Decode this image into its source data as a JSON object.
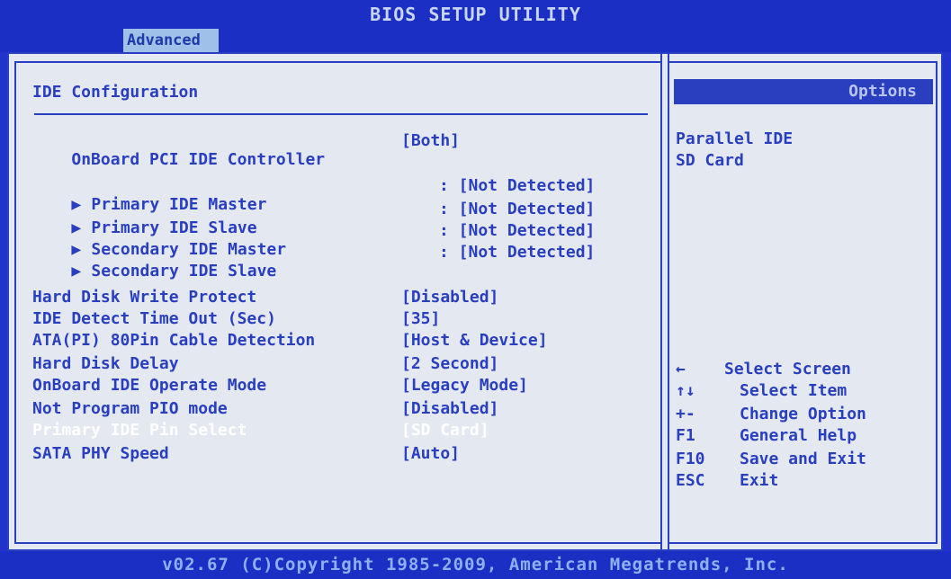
{
  "header": {
    "title": "BIOS SETUP UTILITY",
    "tab": "Advanced"
  },
  "section_title": "IDE Configuration",
  "controller": {
    "label": "OnBoard PCI IDE Controller",
    "value": "[Both]"
  },
  "submenus": [
    {
      "label": "Primary IDE Master",
      "value": ": [Not Detected]"
    },
    {
      "label": "Primary IDE Slave",
      "value": ": [Not Detected]"
    },
    {
      "label": "Secondary IDE Master",
      "value": ": [Not Detected]"
    },
    {
      "label": "Secondary IDE Slave",
      "value": ": [Not Detected]"
    }
  ],
  "settings": [
    {
      "label": "Hard Disk Write Protect",
      "value": "[Disabled]"
    },
    {
      "label": "IDE Detect Time Out (Sec)",
      "value": "[35]"
    },
    {
      "label": "ATA(PI) 80Pin Cable Detection",
      "value": "[Host & Device]"
    },
    {
      "label": "Hard Disk Delay",
      "value": "[2 Second]"
    },
    {
      "label": "OnBoard IDE Operate Mode",
      "value": "[Legacy Mode]"
    },
    {
      "label": "Not Program PIO mode",
      "value": "[Disabled]"
    },
    {
      "label": "Primary IDE Pin Select",
      "value": "[SD Card]"
    },
    {
      "label": "SATA PHY Speed",
      "value": "[Auto]"
    }
  ],
  "options": {
    "title": "Options",
    "items": [
      "Parallel IDE",
      "SD Card"
    ]
  },
  "help": [
    {
      "key": "←",
      "text": "Select Screen"
    },
    {
      "key": "↑↓",
      "text": "Select Item"
    },
    {
      "key": "+-",
      "text": "Change Option"
    },
    {
      "key": "F1",
      "text": "General Help"
    },
    {
      "key": "F10",
      "text": "Save and Exit"
    },
    {
      "key": "ESC",
      "text": "Exit"
    }
  ],
  "footer": "v02.67 (C)Copyright 1985-2009, American Megatrends, Inc.",
  "colors": {
    "background": "#2233cc",
    "panel": "#e4e9f1",
    "text": "#2a3ec0",
    "highlight": "#ffffff"
  }
}
